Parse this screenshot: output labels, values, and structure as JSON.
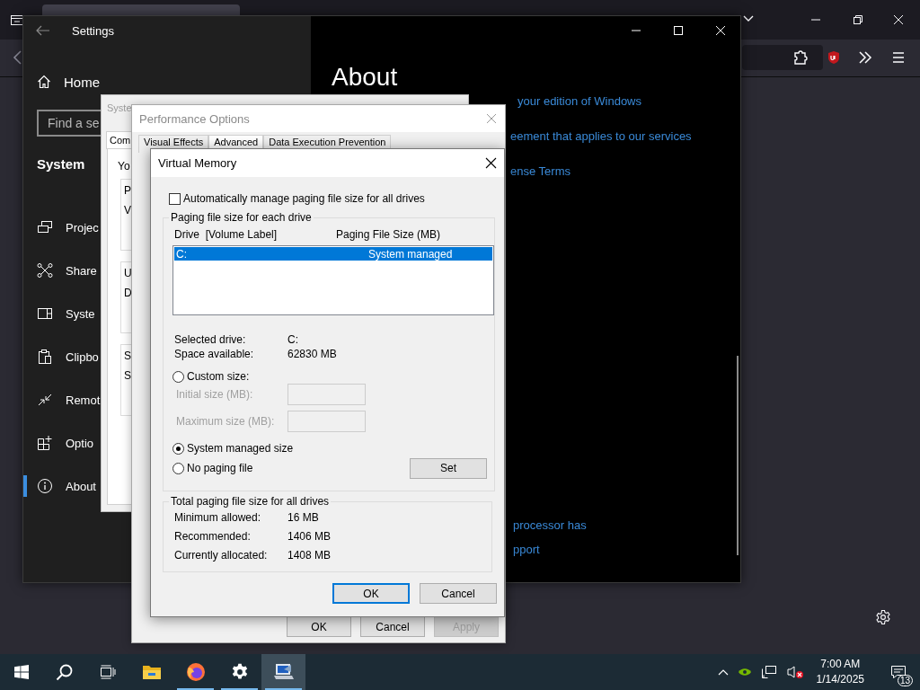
{
  "settings": {
    "title": "Settings",
    "home": "Home",
    "search_placeholder": "Find a se",
    "section": "System",
    "nav": [
      {
        "kind": "projecting",
        "label": "Projec",
        "selected": false
      },
      {
        "kind": "shared",
        "label": "Share",
        "selected": false
      },
      {
        "kind": "components",
        "label": "Syste",
        "selected": false
      },
      {
        "kind": "clipboard",
        "label": "Clipbo",
        "selected": false
      },
      {
        "kind": "remote",
        "label": "Remot",
        "selected": false
      },
      {
        "kind": "optional",
        "label": "Optio",
        "selected": false
      },
      {
        "kind": "about",
        "label": "About",
        "selected": true
      }
    ],
    "heading": "About",
    "links_upper": [
      "your edition of Windows",
      "eement that applies to our services",
      "ense Terms"
    ],
    "links_lower": [
      "processor has",
      "pport"
    ]
  },
  "system_properties": {
    "title": "Syste",
    "tab": "Com",
    "intro": "Yo",
    "groups": [
      {
        "lines": [
          "P",
          "V"
        ]
      },
      {
        "lines": [
          "U",
          "D"
        ]
      },
      {
        "lines": [
          "S",
          "S"
        ]
      }
    ]
  },
  "performance_options": {
    "title": "Performance Options",
    "tabs": [
      {
        "label": "Visual Effects",
        "selected": false
      },
      {
        "label": "Advanced",
        "selected": true
      },
      {
        "label": "Data Execution Prevention",
        "selected": false
      }
    ],
    "buttons": [
      {
        "label": "OK",
        "disabled": false
      },
      {
        "label": "Cancel",
        "disabled": false
      },
      {
        "label": "Apply",
        "disabled": true
      }
    ]
  },
  "virtual_memory": {
    "title": "Virtual Memory",
    "auto_manage": {
      "label": "Automatically manage paging file size for all drives",
      "checked": false
    },
    "drives_group": "Paging file size for each drive",
    "columns": [
      "Drive  [Volume Label]",
      "Paging File Size (MB)"
    ],
    "drives": [
      {
        "drive": "C:",
        "size": "System managed",
        "selected": true
      }
    ],
    "selected_drive_label": "Selected drive:",
    "selected_drive": "C:",
    "space_label": "Space available:",
    "space": "62830 MB",
    "size_options": [
      {
        "kind": "custom",
        "label": "Custom size:",
        "selected": false
      },
      {
        "kind": "system",
        "label": "System managed size",
        "selected": true
      },
      {
        "kind": "none",
        "label": "No paging file",
        "selected": false
      }
    ],
    "initial_label": "Initial size (MB):",
    "maximum_label": "Maximum size (MB):",
    "set_button": "Set",
    "totals_group": "Total paging file size for all drives",
    "totals": [
      {
        "label": "Minimum allowed:",
        "value": "16 MB"
      },
      {
        "label": "Recommended:",
        "value": "1406 MB"
      },
      {
        "label": "Currently allocated:",
        "value": "1408 MB"
      }
    ],
    "buttons": [
      {
        "label": "OK",
        "default": true
      },
      {
        "label": "Cancel",
        "default": false
      }
    ]
  },
  "taskbar": {
    "apps": [
      {
        "kind": "explorer",
        "running": false,
        "selected": false
      },
      {
        "kind": "firefox",
        "running": true,
        "selected": false
      },
      {
        "kind": "settings",
        "running": true,
        "selected": false
      },
      {
        "kind": "system",
        "running": true,
        "selected": true
      }
    ],
    "time": "7:00 AM",
    "date": "1/14/2025",
    "notifications": "13"
  }
}
